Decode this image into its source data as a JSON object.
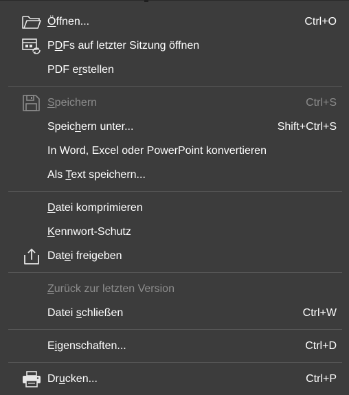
{
  "menu": {
    "items": [
      {
        "pre": "",
        "u": "Ö",
        "post": "ffnen...",
        "shortcut": "Ctrl+O",
        "icon": "folder-open-icon"
      },
      {
        "pre": "P",
        "u": "D",
        "post": "Fs auf letzter Sitzung öffnen",
        "shortcut": "",
        "icon": "recent-pdf-sync-icon"
      },
      {
        "pre": "PDF e",
        "u": "r",
        "post": "stellen",
        "shortcut": ""
      },
      {
        "pre": "",
        "u": "S",
        "post": "peichern",
        "shortcut": "Ctrl+S",
        "icon": "save-icon",
        "disabled": true
      },
      {
        "pre": "Speic",
        "u": "h",
        "post": "ern unter...",
        "shortcut": "Shift+Ctrl+S"
      },
      {
        "pre": "In Word, Excel oder PowerPoint konvertieren",
        "u": "",
        "post": "",
        "shortcut": ""
      },
      {
        "pre": "Als ",
        "u": "T",
        "post": "ext speichern...",
        "shortcut": ""
      },
      {
        "pre": "",
        "u": "D",
        "post": "atei komprimieren",
        "shortcut": ""
      },
      {
        "pre": "",
        "u": "K",
        "post": "ennwort-Schutz",
        "shortcut": ""
      },
      {
        "pre": "Dat",
        "u": "e",
        "post": "i freigeben",
        "shortcut": "",
        "icon": "share-icon"
      },
      {
        "pre": "",
        "u": "Z",
        "post": "urück zur letzten Version",
        "shortcut": "",
        "disabled": true
      },
      {
        "pre": "Datei ",
        "u": "s",
        "post": "chließen",
        "shortcut": "Ctrl+W"
      },
      {
        "pre": "E",
        "u": "i",
        "post": "genschaften...",
        "shortcut": "Ctrl+D"
      },
      {
        "pre": "Dr",
        "u": "u",
        "post": "cken...",
        "shortcut": "Ctrl+P",
        "icon": "printer-icon"
      }
    ]
  },
  "colors": {
    "background": "#3c3c3c",
    "text": "#ffffff",
    "disabled_text": "#8c8c8c",
    "separator": "#5a5a5a"
  }
}
